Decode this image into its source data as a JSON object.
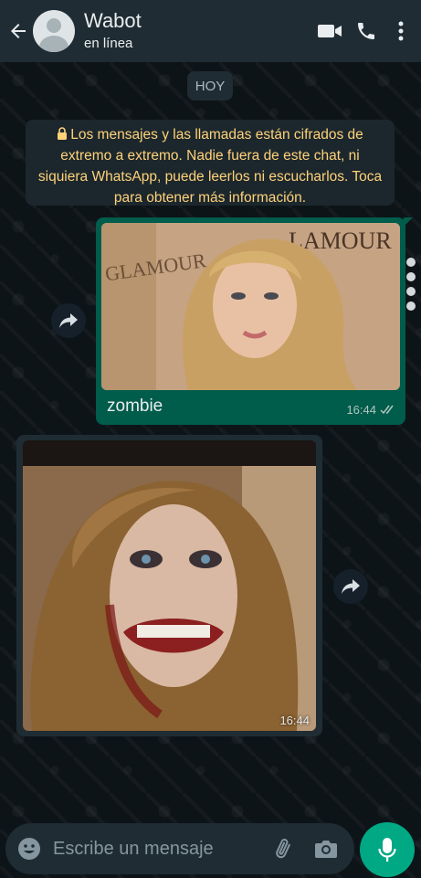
{
  "header": {
    "contact_name": "Wabot",
    "status": "en línea",
    "icons": [
      "back-arrow-icon",
      "video-call-icon",
      "phone-icon",
      "more-vertical-icon"
    ]
  },
  "chat": {
    "date_label": "HOY",
    "encryption_notice": "Los mensajes y las llamadas están cifrados de extremo a extremo. Nadie fuera de este chat, ni siquiera WhatsApp, puede leerlos ni escucharlos. Toca para obtener más información.",
    "messages": [
      {
        "direction": "outgoing",
        "type": "image",
        "caption": "zombie",
        "time": "16:44",
        "status": "read"
      },
      {
        "direction": "incoming",
        "type": "image",
        "time": "16:44"
      }
    ]
  },
  "composer": {
    "placeholder": "Escribe un mensaje",
    "icons": [
      "emoji-icon",
      "attach-icon",
      "camera-icon",
      "mic-icon"
    ]
  },
  "colors": {
    "header_bg": "#1f2c33",
    "outgoing_bubble": "#005c4b",
    "incoming_bubble": "#1f2c33",
    "notice_text": "#ffd279",
    "accent": "#00a884"
  }
}
